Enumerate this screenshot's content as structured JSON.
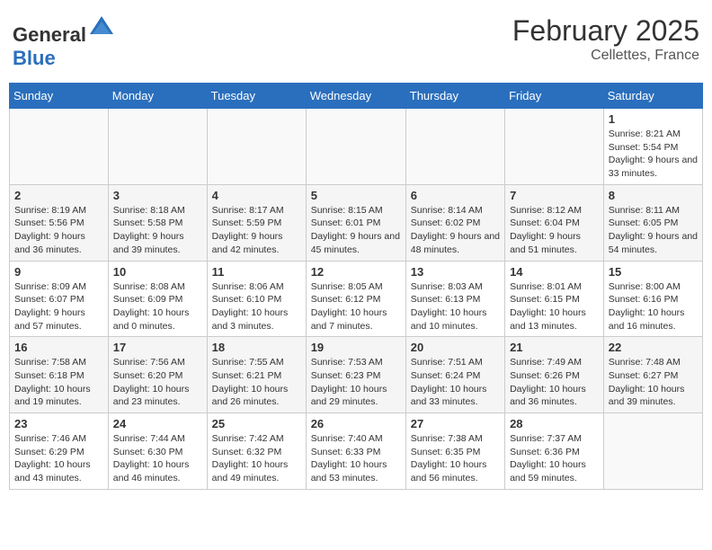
{
  "header": {
    "logo_general": "General",
    "logo_blue": "Blue",
    "month_year": "February 2025",
    "location": "Cellettes, France"
  },
  "days_of_week": [
    "Sunday",
    "Monday",
    "Tuesday",
    "Wednesday",
    "Thursday",
    "Friday",
    "Saturday"
  ],
  "weeks": [
    {
      "days": [
        {
          "num": "",
          "info": ""
        },
        {
          "num": "",
          "info": ""
        },
        {
          "num": "",
          "info": ""
        },
        {
          "num": "",
          "info": ""
        },
        {
          "num": "",
          "info": ""
        },
        {
          "num": "",
          "info": ""
        },
        {
          "num": "1",
          "info": "Sunrise: 8:21 AM\nSunset: 5:54 PM\nDaylight: 9 hours and 33 minutes."
        }
      ]
    },
    {
      "days": [
        {
          "num": "2",
          "info": "Sunrise: 8:19 AM\nSunset: 5:56 PM\nDaylight: 9 hours and 36 minutes."
        },
        {
          "num": "3",
          "info": "Sunrise: 8:18 AM\nSunset: 5:58 PM\nDaylight: 9 hours and 39 minutes."
        },
        {
          "num": "4",
          "info": "Sunrise: 8:17 AM\nSunset: 5:59 PM\nDaylight: 9 hours and 42 minutes."
        },
        {
          "num": "5",
          "info": "Sunrise: 8:15 AM\nSunset: 6:01 PM\nDaylight: 9 hours and 45 minutes."
        },
        {
          "num": "6",
          "info": "Sunrise: 8:14 AM\nSunset: 6:02 PM\nDaylight: 9 hours and 48 minutes."
        },
        {
          "num": "7",
          "info": "Sunrise: 8:12 AM\nSunset: 6:04 PM\nDaylight: 9 hours and 51 minutes."
        },
        {
          "num": "8",
          "info": "Sunrise: 8:11 AM\nSunset: 6:05 PM\nDaylight: 9 hours and 54 minutes."
        }
      ]
    },
    {
      "days": [
        {
          "num": "9",
          "info": "Sunrise: 8:09 AM\nSunset: 6:07 PM\nDaylight: 9 hours and 57 minutes."
        },
        {
          "num": "10",
          "info": "Sunrise: 8:08 AM\nSunset: 6:09 PM\nDaylight: 10 hours and 0 minutes."
        },
        {
          "num": "11",
          "info": "Sunrise: 8:06 AM\nSunset: 6:10 PM\nDaylight: 10 hours and 3 minutes."
        },
        {
          "num": "12",
          "info": "Sunrise: 8:05 AM\nSunset: 6:12 PM\nDaylight: 10 hours and 7 minutes."
        },
        {
          "num": "13",
          "info": "Sunrise: 8:03 AM\nSunset: 6:13 PM\nDaylight: 10 hours and 10 minutes."
        },
        {
          "num": "14",
          "info": "Sunrise: 8:01 AM\nSunset: 6:15 PM\nDaylight: 10 hours and 13 minutes."
        },
        {
          "num": "15",
          "info": "Sunrise: 8:00 AM\nSunset: 6:16 PM\nDaylight: 10 hours and 16 minutes."
        }
      ]
    },
    {
      "days": [
        {
          "num": "16",
          "info": "Sunrise: 7:58 AM\nSunset: 6:18 PM\nDaylight: 10 hours and 19 minutes."
        },
        {
          "num": "17",
          "info": "Sunrise: 7:56 AM\nSunset: 6:20 PM\nDaylight: 10 hours and 23 minutes."
        },
        {
          "num": "18",
          "info": "Sunrise: 7:55 AM\nSunset: 6:21 PM\nDaylight: 10 hours and 26 minutes."
        },
        {
          "num": "19",
          "info": "Sunrise: 7:53 AM\nSunset: 6:23 PM\nDaylight: 10 hours and 29 minutes."
        },
        {
          "num": "20",
          "info": "Sunrise: 7:51 AM\nSunset: 6:24 PM\nDaylight: 10 hours and 33 minutes."
        },
        {
          "num": "21",
          "info": "Sunrise: 7:49 AM\nSunset: 6:26 PM\nDaylight: 10 hours and 36 minutes."
        },
        {
          "num": "22",
          "info": "Sunrise: 7:48 AM\nSunset: 6:27 PM\nDaylight: 10 hours and 39 minutes."
        }
      ]
    },
    {
      "days": [
        {
          "num": "23",
          "info": "Sunrise: 7:46 AM\nSunset: 6:29 PM\nDaylight: 10 hours and 43 minutes."
        },
        {
          "num": "24",
          "info": "Sunrise: 7:44 AM\nSunset: 6:30 PM\nDaylight: 10 hours and 46 minutes."
        },
        {
          "num": "25",
          "info": "Sunrise: 7:42 AM\nSunset: 6:32 PM\nDaylight: 10 hours and 49 minutes."
        },
        {
          "num": "26",
          "info": "Sunrise: 7:40 AM\nSunset: 6:33 PM\nDaylight: 10 hours and 53 minutes."
        },
        {
          "num": "27",
          "info": "Sunrise: 7:38 AM\nSunset: 6:35 PM\nDaylight: 10 hours and 56 minutes."
        },
        {
          "num": "28",
          "info": "Sunrise: 7:37 AM\nSunset: 6:36 PM\nDaylight: 10 hours and 59 minutes."
        },
        {
          "num": "",
          "info": ""
        }
      ]
    }
  ]
}
